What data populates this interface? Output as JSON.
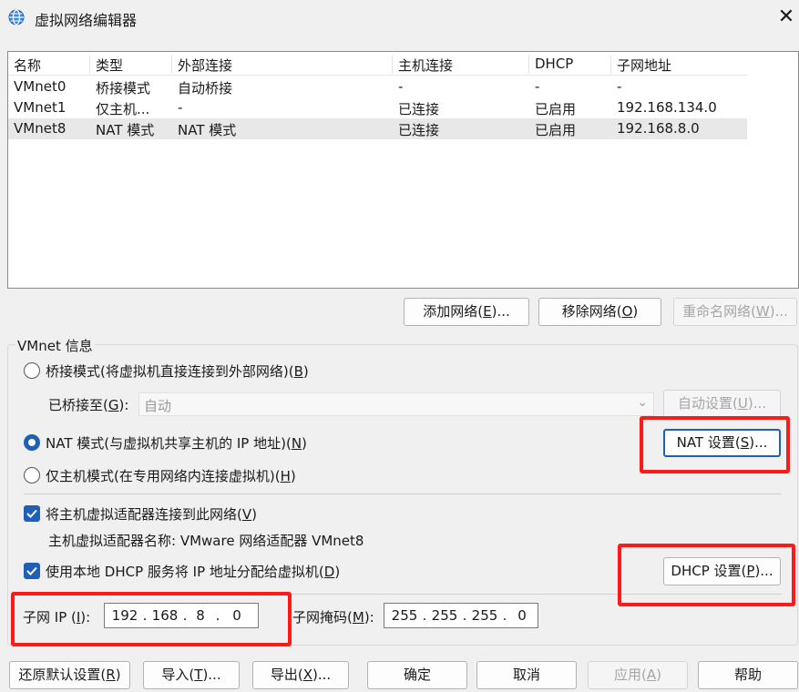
{
  "window": {
    "title": "虚拟网络编辑器",
    "icon": "globe-icon",
    "close_glyph": "✕"
  },
  "table": {
    "headers": [
      "名称",
      "类型",
      "外部连接",
      "主机连接",
      "DHCP",
      "子网地址"
    ],
    "rows": [
      [
        "VMnet0",
        "桥接模式",
        "自动桥接",
        "-",
        "-",
        "-"
      ],
      [
        "VMnet1",
        "仅主机...",
        "-",
        "已连接",
        "已启用",
        "192.168.134.0"
      ],
      [
        "VMnet8",
        "NAT 模式",
        "NAT 模式",
        "已连接",
        "已启用",
        "192.168.8.0"
      ]
    ],
    "selected_row": 2
  },
  "list_buttons": {
    "add": {
      "pre": "添加网络(",
      "key": "E",
      "post": ")..."
    },
    "remove": {
      "pre": "移除网络(",
      "key": "O",
      "post": ")"
    },
    "rename": {
      "pre": "重命名网络(",
      "key": "W",
      "post": ")..."
    }
  },
  "vmnet_info": {
    "group_title": "VMnet 信息",
    "bridge_radio": {
      "pre": "桥接模式(将虚拟机直接连接到外部网络)(",
      "key": "B",
      "post": ")",
      "checked": false
    },
    "bridged_to": {
      "pre": "已桥接至(",
      "key": "G",
      "post": "):",
      "value": "自动"
    },
    "auto_settings": {
      "pre": "自动设置(",
      "key": "U",
      "post": ")..."
    },
    "nat_radio": {
      "pre": "NAT 模式(与虚拟机共享主机的 IP 地址)(",
      "key": "N",
      "post": ")",
      "checked": true
    },
    "nat_settings": {
      "pre": "NAT 设置(",
      "key": "S",
      "post": ")..."
    },
    "hostonly_radio": {
      "pre": "仅主机模式(在专用网络内连接虚拟机)(",
      "key": "H",
      "post": ")",
      "checked": false
    },
    "connect_adapter": {
      "pre": "将主机虚拟适配器连接到此网络(",
      "key": "V",
      "post": ")",
      "checked": true
    },
    "adapter_name": "主机虚拟适配器名称: VMware 网络适配器 VMnet8",
    "use_dhcp": {
      "pre": "使用本地 DHCP 服务将 IP 地址分配给虚拟机(",
      "key": "D",
      "post": ")",
      "checked": true
    },
    "dhcp_settings": {
      "pre": "DHCP 设置(",
      "key": "P",
      "post": ")..."
    },
    "subnet_ip": {
      "pre": "子网 IP (",
      "key": "I",
      "post": "):",
      "octets": [
        "192",
        "168",
        "8",
        "0"
      ]
    },
    "subnet_mask": {
      "pre": "子网掩码(",
      "key": "M",
      "post": "):",
      "octets": [
        "255",
        "255",
        "255",
        "0"
      ]
    }
  },
  "footer_buttons": {
    "restore": {
      "pre": "还原默认设置(",
      "key": "R",
      "post": ")"
    },
    "import": {
      "pre": "导入(",
      "key": "T",
      "post": ")..."
    },
    "export": {
      "pre": "导出(",
      "key": "X",
      "post": ")..."
    },
    "ok": {
      "pre": "确定",
      "key": "",
      "post": ""
    },
    "cancel": {
      "pre": "取消",
      "key": "",
      "post": ""
    },
    "apply": {
      "pre": "应用(",
      "key": "A",
      "post": ")"
    },
    "help": {
      "pre": "帮助",
      "key": "",
      "post": ""
    }
  },
  "colors": {
    "accent": "#1f5fb6",
    "annotation": "#ff1a1a",
    "window_bg": "#f0f0f0"
  }
}
